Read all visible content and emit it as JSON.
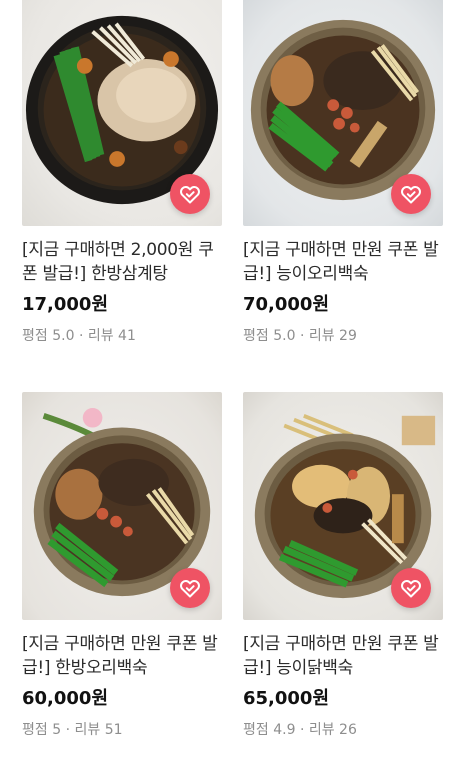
{
  "products": [
    {
      "title": "[지금 구매하면 2,000원 쿠폰 발급!] 한방삼계탕",
      "price": "17,000원",
      "rating_label": "평점 5.0",
      "separator": "·",
      "review_label": "리뷰 41"
    },
    {
      "title": "[지금 구매하면 만원 쿠폰 발급!] 능이오리백숙",
      "price": "70,000원",
      "rating_label": "평점 5.0",
      "separator": "·",
      "review_label": "리뷰 29"
    },
    {
      "title": "[지금 구매하면 만원 쿠폰 발급!] 한방오리백숙",
      "price": "60,000원",
      "rating_label": "평점 5",
      "separator": "·",
      "review_label": "리뷰 51"
    },
    {
      "title": "[지금 구매하면 만원 쿠폰 발급!] 능이닭백숙",
      "price": "65,000원",
      "rating_label": "평점 4.9",
      "separator": "·",
      "review_label": "리뷰 26"
    }
  ],
  "icons": {
    "wishlist": "heart-check-icon"
  },
  "colors": {
    "wishlist_button": "#ef5364",
    "meta_text": "#8e8e8e",
    "price_text": "#111111"
  }
}
